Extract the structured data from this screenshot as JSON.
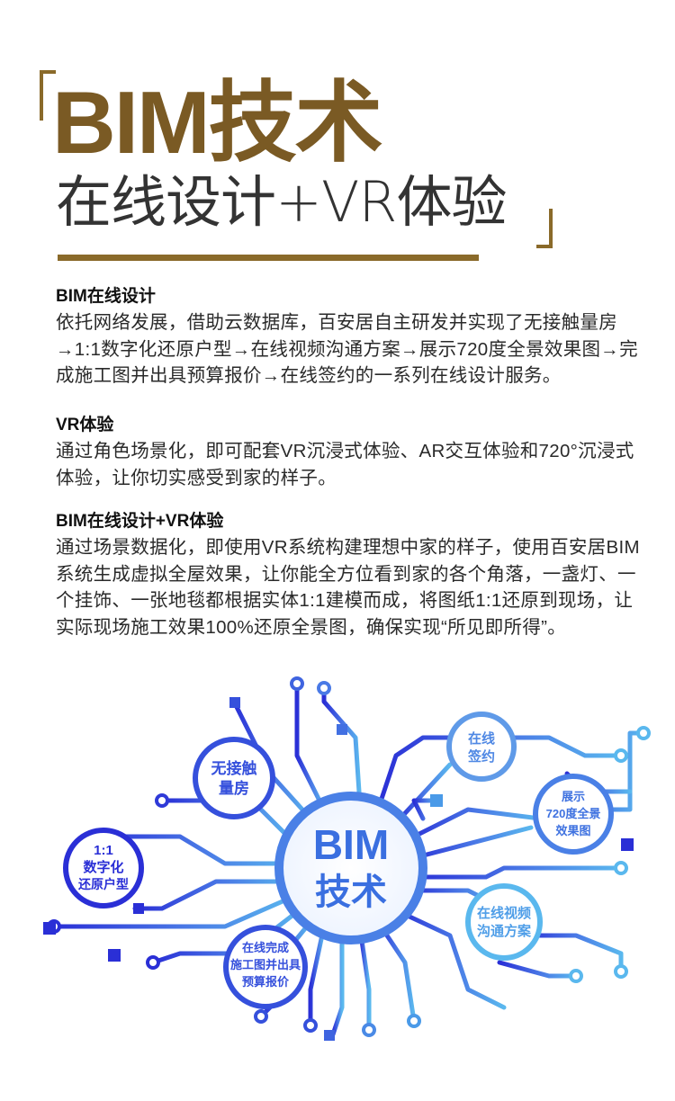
{
  "header": {
    "title_main": "BIM技术",
    "title_sub": "在线设计+VR体验"
  },
  "sections": [
    {
      "heading": "BIM在线设计",
      "body": "依托网络发展，借助云数据库，百安居自主研发并实现了无接触量房→1:1数字化还原户型→在线视频沟通方案→展示720度全景效果图→完成施工图并出具预算报价→在线签约的一系列在线设计服务。"
    },
    {
      "heading": "VR体验",
      "body": "通过角色场景化，即可配套VR沉浸式体验、AR交互体验和720°沉浸式体验，让你切实感受到家的样子。"
    },
    {
      "heading": "BIM在线设计+VR体验",
      "body": "通过场景数据化，即使用VR系统构建理想中家的样子，使用百安居BIM系统生成虚拟全屋效果，让你能全方位看到家的各个角落，一盏灯、一个挂饰、一张地毯都根据实体1:1建模而成，将图纸1:1还原到现场，让实际现场施工效果100%还原全景图，确保实现“所见即所得”。"
    }
  ],
  "diagram": {
    "center": [
      "BIM",
      "技术"
    ],
    "nodes": {
      "measure": [
        "无接触",
        "量房"
      ],
      "sign": [
        "在线",
        "签约"
      ],
      "render": [
        "展示",
        "720度全景",
        "效果图"
      ],
      "digital": [
        "1:1",
        "数字化",
        "还原户型"
      ],
      "video": [
        "在线视频",
        "沟通方案"
      ],
      "drawing": [
        "在线完成",
        "施工图并出具",
        "预算报价"
      ]
    },
    "colors": {
      "circuit_dark": "#2a2fd6",
      "circuit_light": "#5ab8ee",
      "center_text": "#3a6fe0",
      "brand": "#7a5a24"
    }
  }
}
